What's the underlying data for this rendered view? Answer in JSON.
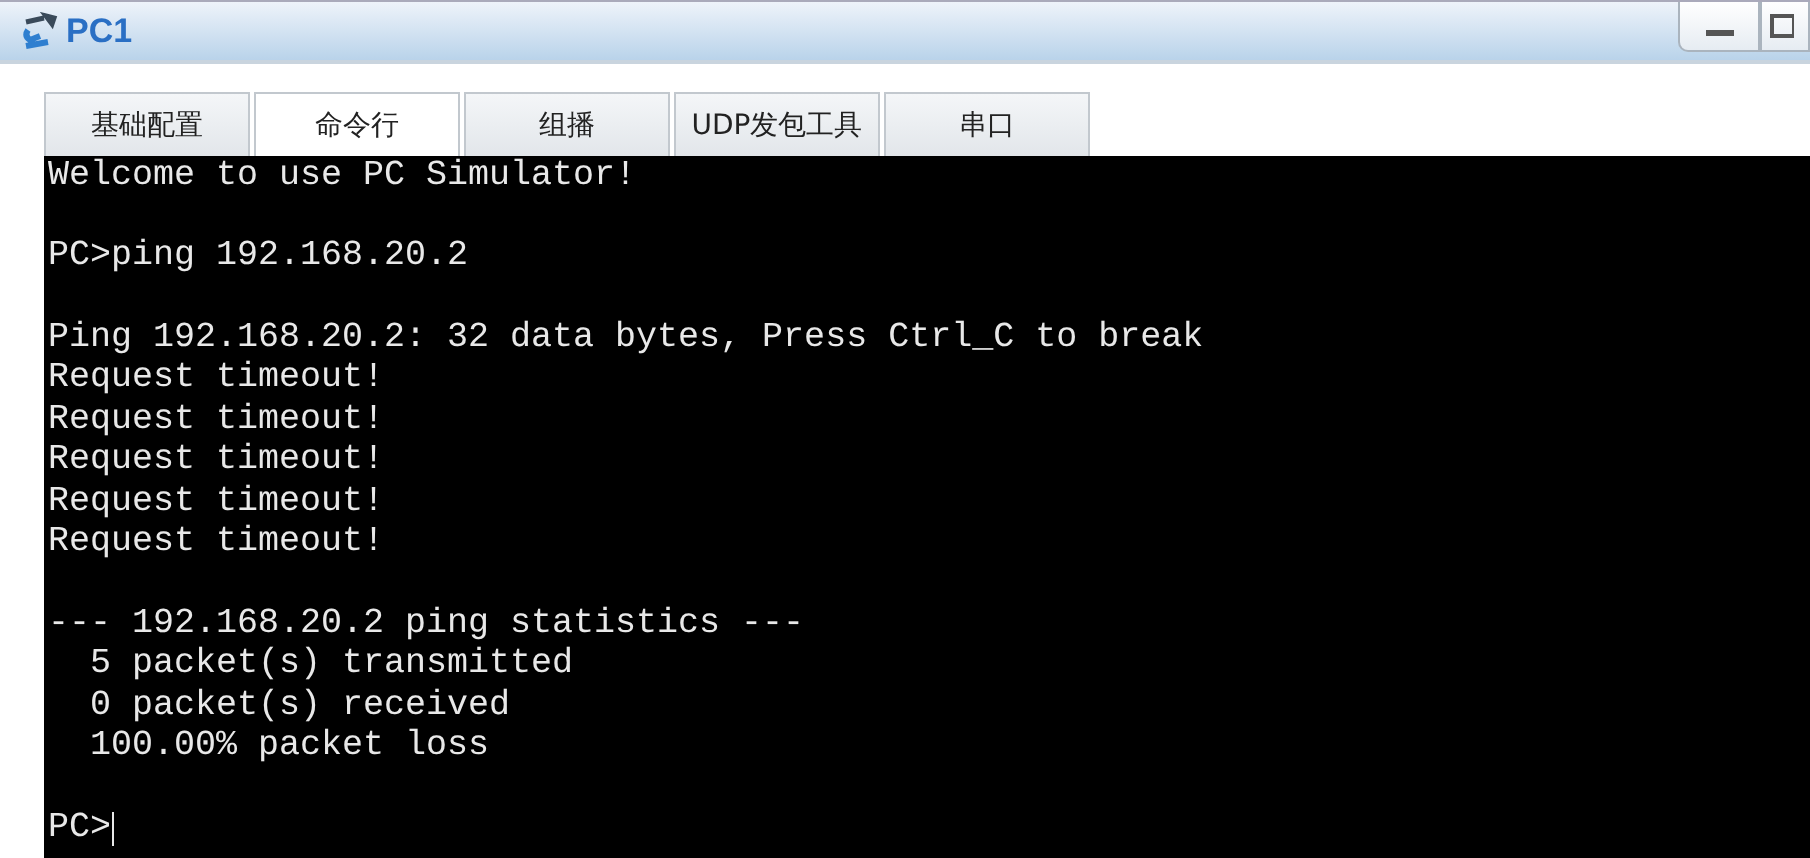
{
  "window": {
    "title": "PC1"
  },
  "tabs": [
    {
      "label": "基础配置",
      "selected": false
    },
    {
      "label": "命令行",
      "selected": true
    },
    {
      "label": "组播",
      "selected": false
    },
    {
      "label": "UDP发包工具",
      "selected": false
    },
    {
      "label": "串口",
      "selected": false
    }
  ],
  "terminal": {
    "blocks": [
      [
        "Welcome to use PC Simulator!"
      ],
      [
        "PC>ping 192.168.20.2"
      ],
      [
        "Ping 192.168.20.2: 32 data bytes, Press Ctrl_C to break",
        "Request timeout!",
        "Request timeout!",
        "Request timeout!",
        "Request timeout!",
        "Request timeout!"
      ],
      [
        "--- 192.168.20.2 ping statistics ---",
        "  5 packet(s) transmitted",
        "  0 packet(s) received",
        "  100.00% packet loss"
      ],
      [
        "PC>"
      ]
    ]
  }
}
